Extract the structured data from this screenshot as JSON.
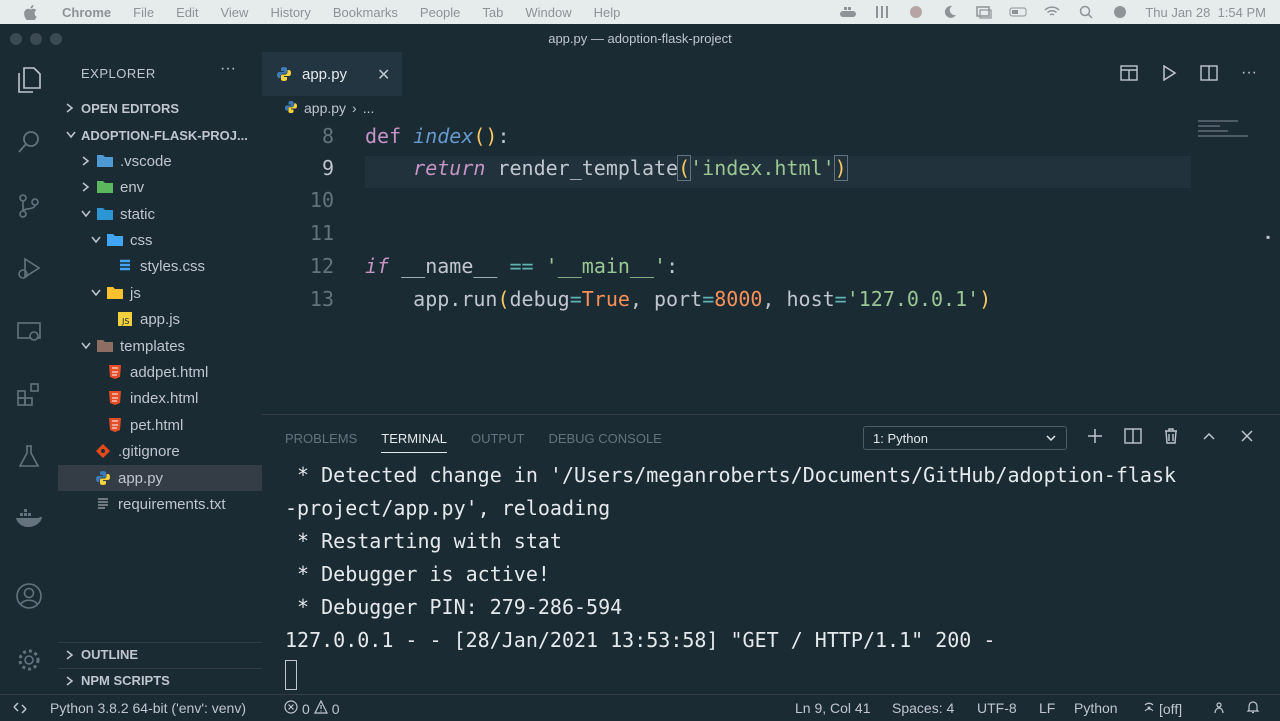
{
  "macos_menu": {
    "app": "Chrome",
    "items": [
      "File",
      "Edit",
      "View",
      "History",
      "Bookmarks",
      "People",
      "Tab",
      "Window",
      "Help"
    ],
    "clock": "Thu Jan 28  1:54 PM"
  },
  "window": {
    "title": "app.py — adoption-flask-project"
  },
  "explorer": {
    "title": "EXPLORER",
    "open_editors": "OPEN EDITORS",
    "project": "ADOPTION-FLASK-PROJ...",
    "tree": [
      {
        "label": ".vscode",
        "depth": 1,
        "kind": "folder",
        "open": false
      },
      {
        "label": "env",
        "depth": 1,
        "kind": "folder",
        "open": false
      },
      {
        "label": "static",
        "depth": 1,
        "kind": "folder",
        "open": true
      },
      {
        "label": "css",
        "depth": 2,
        "kind": "folder",
        "open": true
      },
      {
        "label": "styles.css",
        "depth": 3,
        "kind": "css"
      },
      {
        "label": "js",
        "depth": 2,
        "kind": "folder",
        "open": true
      },
      {
        "label": "app.js",
        "depth": 3,
        "kind": "js"
      },
      {
        "label": "templates",
        "depth": 1,
        "kind": "folder",
        "open": true
      },
      {
        "label": "addpet.html",
        "depth": 2,
        "kind": "html"
      },
      {
        "label": "index.html",
        "depth": 2,
        "kind": "html"
      },
      {
        "label": "pet.html",
        "depth": 2,
        "kind": "html"
      },
      {
        "label": ".gitignore",
        "depth": 1,
        "kind": "git"
      },
      {
        "label": "app.py",
        "depth": 1,
        "kind": "py",
        "selected": true
      },
      {
        "label": "requirements.txt",
        "depth": 1,
        "kind": "txt"
      }
    ],
    "outline": "OUTLINE",
    "npm_scripts": "NPM SCRIPTS"
  },
  "editor": {
    "tab_label": "app.py",
    "breadcrumb_file": "app.py",
    "breadcrumb_more": "...",
    "line_numbers": [
      "8",
      "9",
      "10",
      "11",
      "12",
      "13"
    ],
    "current_line": "9"
  },
  "panel": {
    "tabs": [
      "PROBLEMS",
      "TERMINAL",
      "OUTPUT",
      "DEBUG CONSOLE"
    ],
    "active_tab": "TERMINAL",
    "terminal_select": "1: Python",
    "terminal_lines": [
      " * Detected change in '/Users/meganroberts/Documents/GitHub/adoption-flask",
      "-project/app.py', reloading",
      " * Restarting with stat",
      " * Debugger is active!",
      " * Debugger PIN: 279-286-594",
      "127.0.0.1 - - [28/Jan/2021 13:53:58] \"GET / HTTP/1.1\" 200 -"
    ]
  },
  "statusbar": {
    "interpreter": "Python 3.8.2 64-bit ('env': venv)",
    "errors": "0",
    "warnings": "0",
    "position": "Ln 9, Col 41",
    "spaces": "Spaces: 4",
    "encoding": "UTF-8",
    "eol": "LF",
    "language": "Python",
    "live": "[off]"
  },
  "colors": {
    "background": "#1b2b34",
    "keyword": "#c594c5",
    "function": "#6699cc",
    "string": "#99c794",
    "number": "#f99157",
    "selection": "#343d46"
  }
}
